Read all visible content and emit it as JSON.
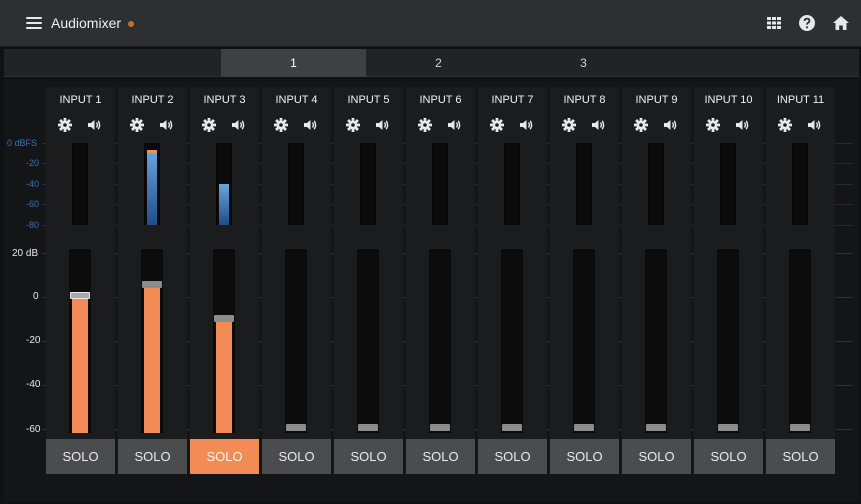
{
  "app": {
    "title": "Audiomixer",
    "status_color": "#c0703a"
  },
  "header": {
    "icons": [
      "grid-icon",
      "help-icon",
      "home-icon"
    ]
  },
  "tabs": [
    {
      "label": "1",
      "active": true
    },
    {
      "label": "2",
      "active": false
    },
    {
      "label": "3",
      "active": false
    }
  ],
  "meter_scale": [
    "0 dBFS",
    "-20",
    "-40",
    "-60",
    "-80"
  ],
  "gain_scale": [
    "20 dB",
    "0",
    "-20",
    "-40",
    "-60"
  ],
  "colors": {
    "accent": "#f28b55",
    "meter": "#3b73b3",
    "panel": "#1b1c1d"
  },
  "channels": [
    {
      "name": "INPUT 1",
      "solo": "SOLO",
      "solo_active": false,
      "gain_db": 0,
      "meter_l_db": null,
      "meter_r_db": null,
      "selected": true
    },
    {
      "name": "INPUT 2",
      "solo": "SOLO",
      "solo_active": false,
      "gain_db": 5,
      "meter_l_db": -7,
      "meter_r_db": -7,
      "selected": false
    },
    {
      "name": "INPUT 3",
      "solo": "SOLO",
      "solo_active": true,
      "gain_db": -10,
      "meter_l_db": -40,
      "meter_r_db": -40,
      "selected": false
    },
    {
      "name": "INPUT 4",
      "solo": "SOLO",
      "solo_active": false,
      "gain_db": null,
      "meter_l_db": null,
      "meter_r_db": null,
      "selected": false
    },
    {
      "name": "INPUT 5",
      "solo": "SOLO",
      "solo_active": false,
      "gain_db": null,
      "meter_l_db": null,
      "meter_r_db": null,
      "selected": false
    },
    {
      "name": "INPUT 6",
      "solo": "SOLO",
      "solo_active": false,
      "gain_db": null,
      "meter_l_db": null,
      "meter_r_db": null,
      "selected": false
    },
    {
      "name": "INPUT 7",
      "solo": "SOLO",
      "solo_active": false,
      "gain_db": null,
      "meter_l_db": null,
      "meter_r_db": null,
      "selected": false
    },
    {
      "name": "INPUT 8",
      "solo": "SOLO",
      "solo_active": false,
      "gain_db": null,
      "meter_l_db": null,
      "meter_r_db": null,
      "selected": false
    },
    {
      "name": "INPUT 9",
      "solo": "SOLO",
      "solo_active": false,
      "gain_db": null,
      "meter_l_db": null,
      "meter_r_db": null,
      "selected": false
    },
    {
      "name": "INPUT 10",
      "solo": "SOLO",
      "solo_active": false,
      "gain_db": null,
      "meter_l_db": null,
      "meter_r_db": null,
      "selected": false
    },
    {
      "name": "INPUT 11",
      "solo": "SOLO",
      "solo_active": false,
      "gain_db": null,
      "meter_l_db": null,
      "meter_r_db": null,
      "selected": false
    }
  ]
}
